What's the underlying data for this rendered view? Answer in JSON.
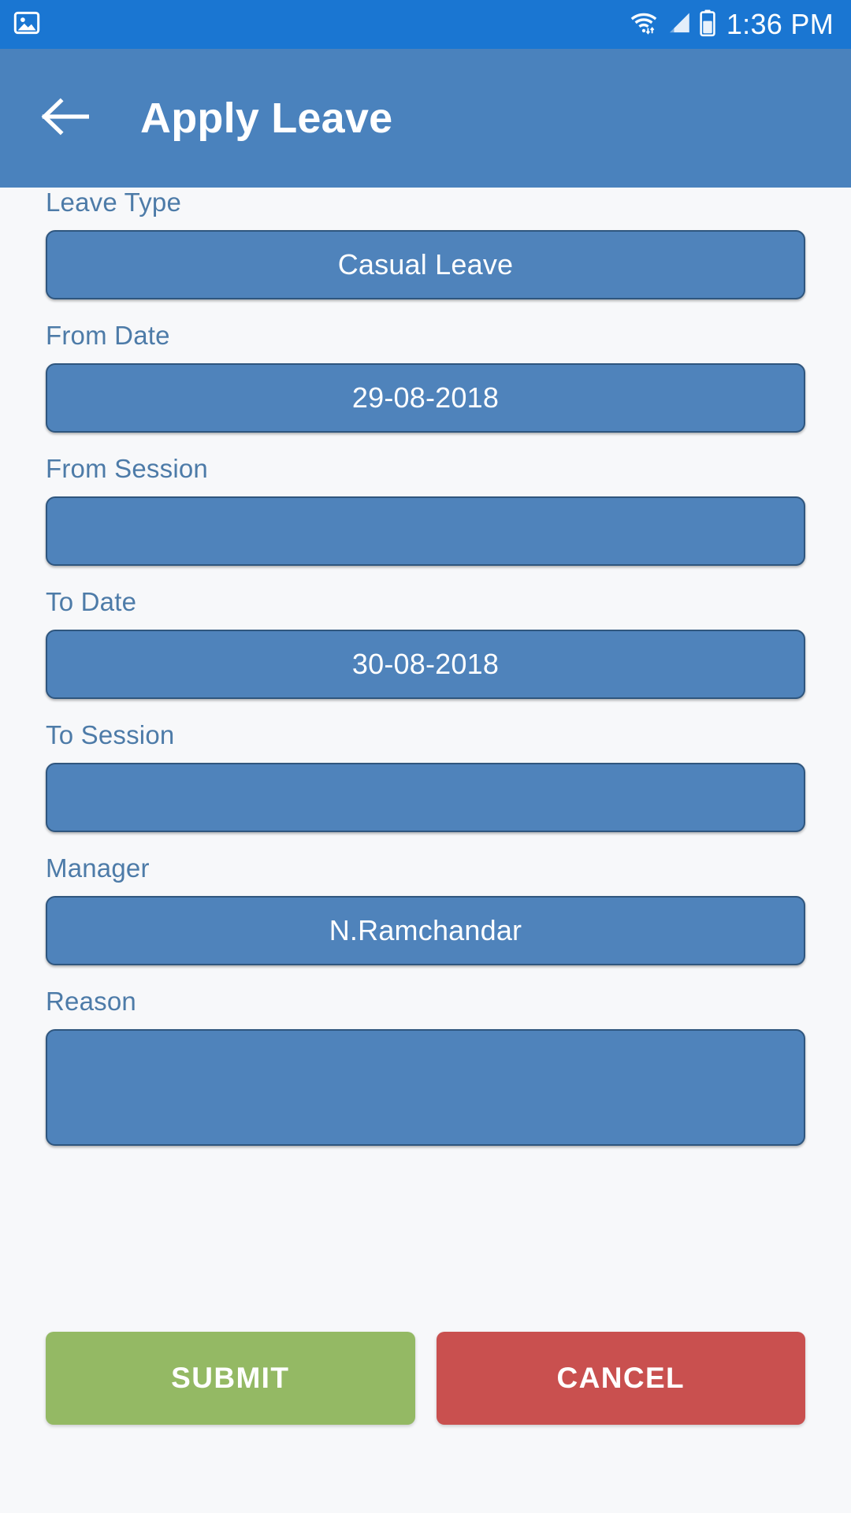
{
  "status_bar": {
    "background": "#1a76d2",
    "time": "1:36 PM",
    "notification_icon": "image-icon",
    "wifi_icon": "wifi-icon",
    "signal_icon": "cellular-signal-icon",
    "battery_icon": "battery-icon"
  },
  "app_bar": {
    "background": "#4a82bd",
    "back_icon": "arrow-left-icon",
    "title": "Apply Leave"
  },
  "theme": {
    "page_background": "#f7f8fa",
    "field_fill": "#4f83bb",
    "field_border": "#2f567e",
    "label_color": "#4d7ba8",
    "submit_color": "#94b964",
    "cancel_color": "#c9504f"
  },
  "form": {
    "fields": [
      {
        "label": "Leave Type",
        "value": "Casual Leave",
        "tall": false
      },
      {
        "label": "From Date",
        "value": "29-08-2018",
        "tall": false
      },
      {
        "label": "From Session",
        "value": "",
        "tall": false
      },
      {
        "label": "To Date",
        "value": "30-08-2018",
        "tall": false
      },
      {
        "label": "To Session",
        "value": "",
        "tall": false
      },
      {
        "label": "Manager",
        "value": "N.Ramchandar",
        "tall": false
      },
      {
        "label": "Reason",
        "value": "",
        "tall": true
      }
    ]
  },
  "actions": {
    "submit_label": "SUBMIT",
    "cancel_label": "CANCEL"
  }
}
